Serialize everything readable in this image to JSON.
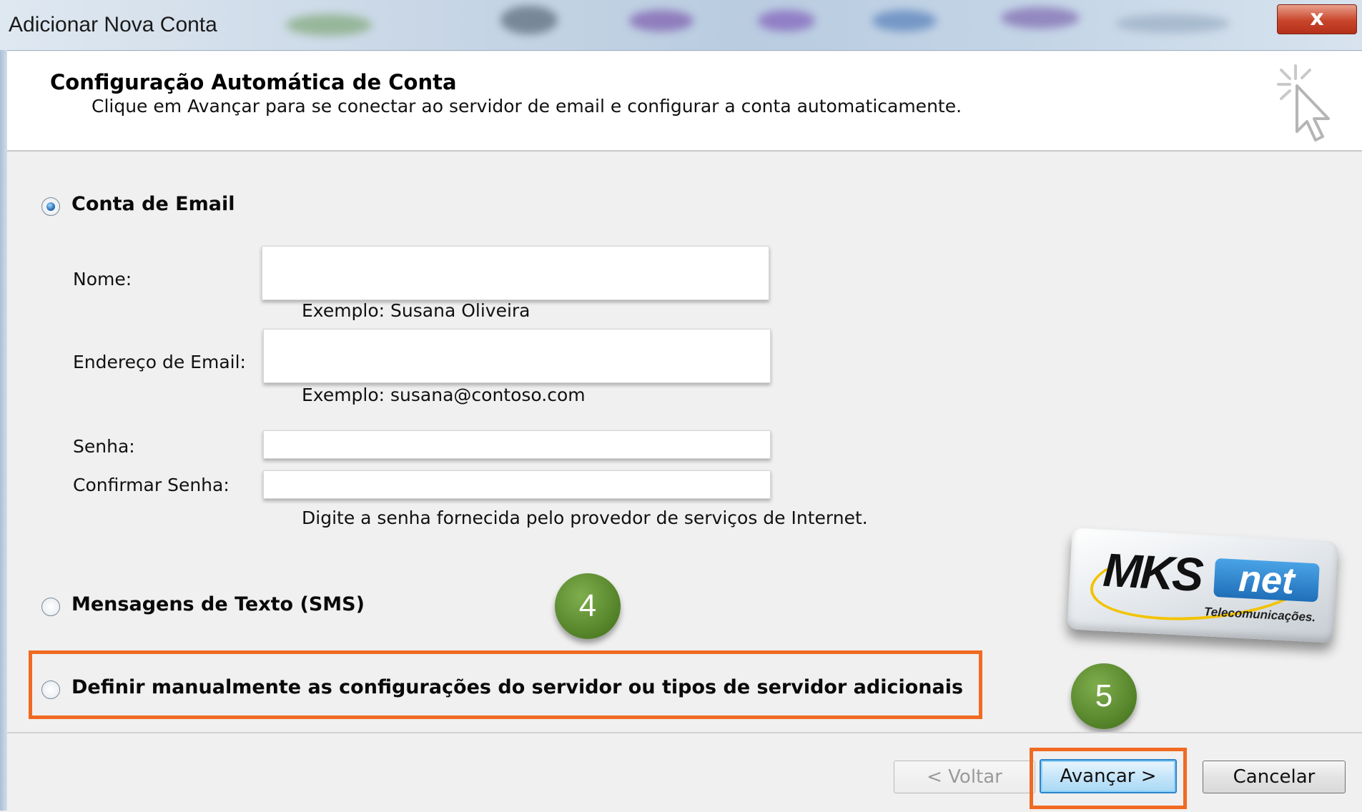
{
  "window": {
    "title": "Adicionar Nova Conta",
    "close_glyph": "x"
  },
  "header": {
    "title": "Configuração Automática de Conta",
    "subtitle": "Clique em Avançar para se conectar ao servidor de email e configurar a conta automaticamente.",
    "icon": "wizard-cursor-icon"
  },
  "options": {
    "email_account": {
      "label": "Conta de Email",
      "selected": true
    },
    "sms": {
      "label": "Mensagens de Texto (SMS)",
      "selected": false
    },
    "manual": {
      "label": "Definir manualmente as configurações do servidor ou tipos de servidor adicionais",
      "selected": false
    }
  },
  "form": {
    "name": {
      "label": "Nome:",
      "value": "",
      "hint": "Exemplo: Susana Oliveira"
    },
    "email": {
      "label": "Endereço de Email:",
      "value": "",
      "hint": "Exemplo: susana@contoso.com"
    },
    "password": {
      "label": "Senha:",
      "value": ""
    },
    "confirm_password": {
      "label": "Confirmar Senha:",
      "value": ""
    },
    "password_hint": "Digite a senha fornecida pelo provedor de serviços de Internet."
  },
  "annotations": {
    "step4": "4",
    "step5": "5",
    "highlight_color": "#f06a22",
    "badge_color": "#5f8f30"
  },
  "logo": {
    "brand_main": "MKS",
    "brand_accent": "net",
    "tagline": "Telecomunicações."
  },
  "footer": {
    "back_label": "< Voltar",
    "back_enabled": false,
    "next_label": "Avançar >",
    "cancel_label": "Cancelar"
  }
}
